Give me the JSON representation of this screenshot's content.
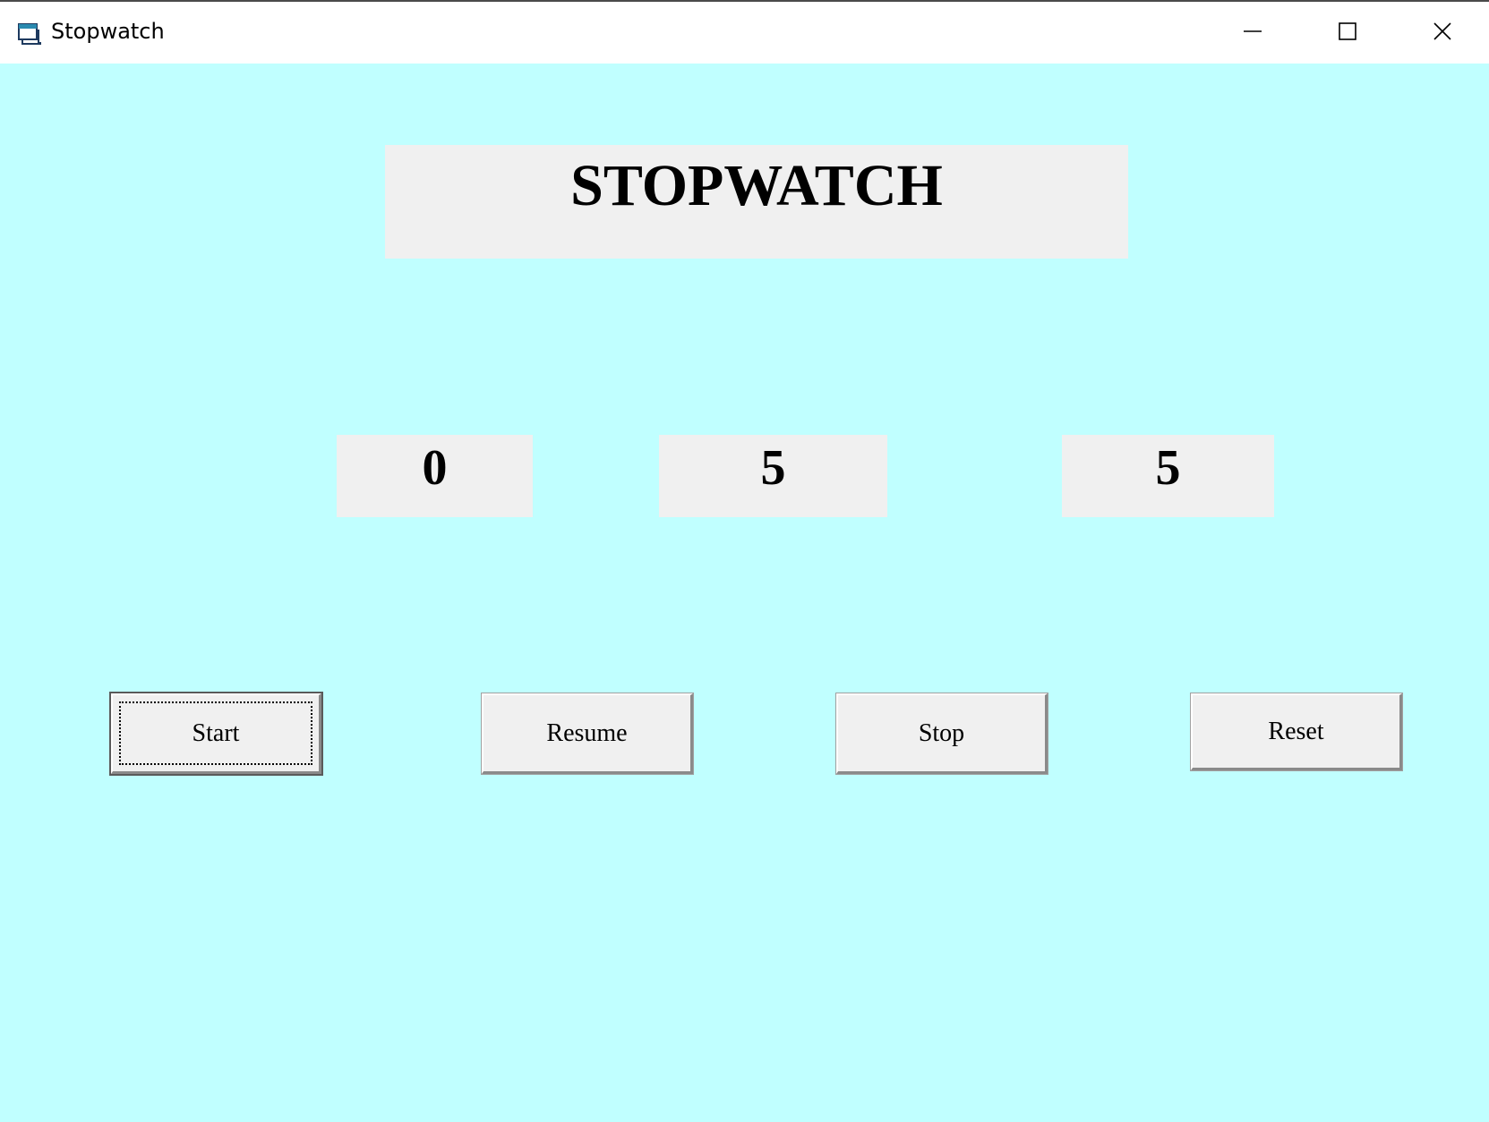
{
  "window": {
    "title": "Stopwatch",
    "icon": "stopwatch-app-icon",
    "controls": [
      "minimize-icon",
      "maximize-icon",
      "close-icon"
    ]
  },
  "main": {
    "heading": "STOPWATCH",
    "background_color": "#c0ffff",
    "time_fields": [
      "0",
      "5",
      "5"
    ],
    "buttons": {
      "start": "Start",
      "resume": "Resume",
      "stop": "Stop",
      "reset": "Reset"
    }
  }
}
